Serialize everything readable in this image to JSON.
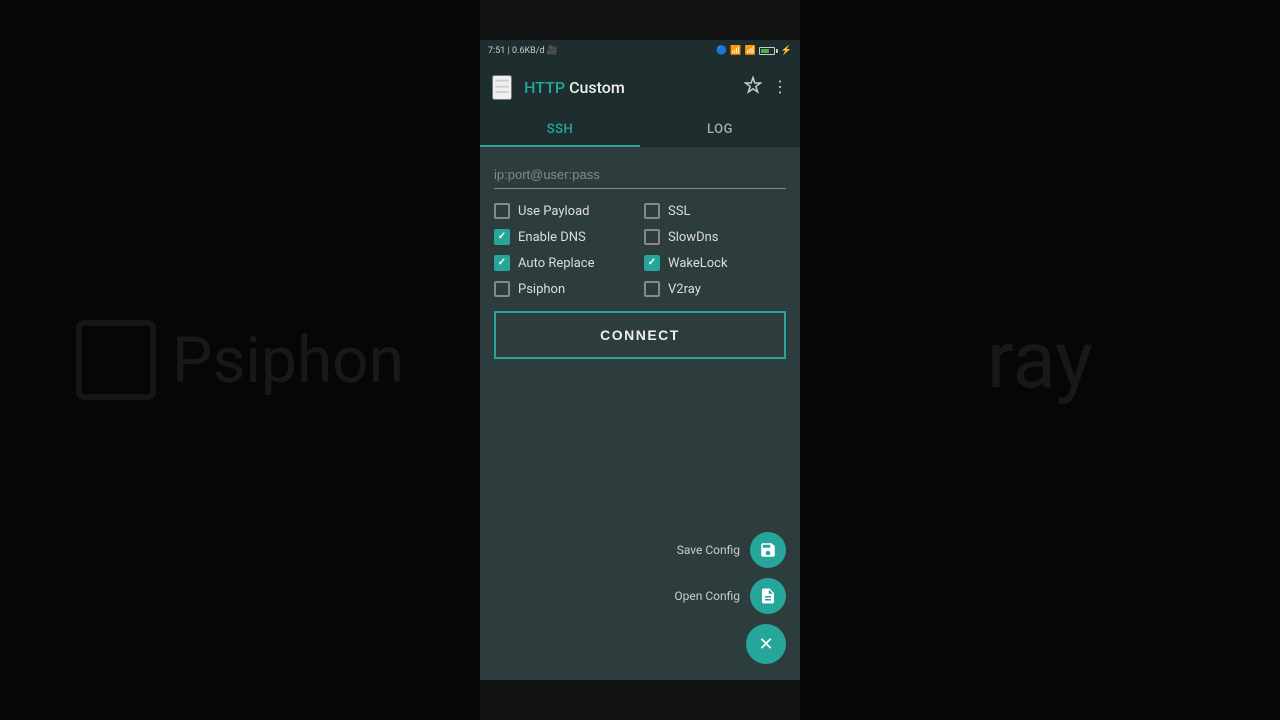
{
  "background": {
    "left_text": "Psiphon",
    "right_text": "ray"
  },
  "status_bar": {
    "time": "7:51",
    "speed": "0.6KB/d",
    "signal": "●●●●",
    "battery_percent": "70"
  },
  "header": {
    "title_http": "HTTP",
    "title_custom": " Custom",
    "menu_icon": "☰",
    "star_icon": "✦",
    "more_icon": "⋮"
  },
  "tabs": [
    {
      "id": "ssh",
      "label": "SSH",
      "active": true
    },
    {
      "id": "log",
      "label": "LOG",
      "active": false
    }
  ],
  "ssh_input": {
    "placeholder": "ip:port@user:pass",
    "value": ""
  },
  "checkboxes": [
    {
      "id": "use-payload",
      "label": "Use Payload",
      "checked": false
    },
    {
      "id": "ssl",
      "label": "SSL",
      "checked": false
    },
    {
      "id": "enable-dns",
      "label": "Enable DNS",
      "checked": true
    },
    {
      "id": "slow-dns",
      "label": "SlowDns",
      "checked": false
    },
    {
      "id": "auto-replace",
      "label": "Auto Replace",
      "checked": true
    },
    {
      "id": "wakelock",
      "label": "WakeLock",
      "checked": true
    },
    {
      "id": "psiphon",
      "label": "Psiphon",
      "checked": false
    },
    {
      "id": "v2ray",
      "label": "V2ray",
      "checked": false
    }
  ],
  "connect_button": {
    "label": "CONNECT"
  },
  "fab": {
    "save_label": "Save Config",
    "save_icon": "💾",
    "open_label": "Open Config",
    "open_icon": "📄",
    "close_icon": "✕"
  }
}
